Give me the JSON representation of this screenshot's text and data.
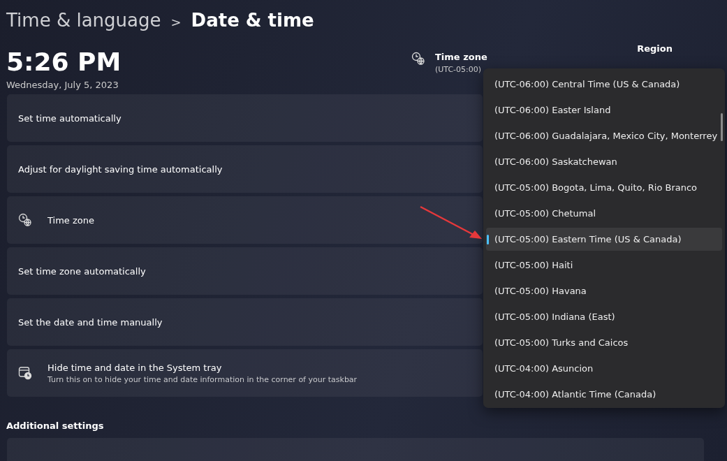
{
  "breadcrumb": {
    "parent": "Time & language",
    "separator": ">",
    "current": "Date & time"
  },
  "clock": {
    "time": "5:26 PM",
    "date": "Wednesday, July 5, 2023"
  },
  "time_zone_info": {
    "title": "Time zone",
    "value": "(UTC-05:00)"
  },
  "region_info": {
    "title": "Region"
  },
  "settings": [
    {
      "kind": "plain",
      "label": "Set time automatically"
    },
    {
      "kind": "plain",
      "label": "Adjust for daylight saving time automatically"
    },
    {
      "kind": "timezone",
      "label": "Time zone"
    },
    {
      "kind": "plain",
      "label": "Set time zone automatically"
    },
    {
      "kind": "plain",
      "label": "Set the date and time manually"
    },
    {
      "kind": "tray",
      "label": "Hide time and date in the System tray",
      "description": "Turn this on to hide your time and date information in the corner of your taskbar"
    }
  ],
  "additional_settings": {
    "heading": "Additional settings"
  },
  "timezone_dropdown": [
    {
      "label": "(UTC-06:00) Central Time (US & Canada)",
      "selected": false
    },
    {
      "label": "(UTC-06:00) Easter Island",
      "selected": false
    },
    {
      "label": "(UTC-06:00) Guadalajara, Mexico City, Monterrey",
      "selected": false
    },
    {
      "label": "(UTC-06:00) Saskatchewan",
      "selected": false
    },
    {
      "label": "(UTC-05:00) Bogota, Lima, Quito, Rio Branco",
      "selected": false
    },
    {
      "label": "(UTC-05:00) Chetumal",
      "selected": false
    },
    {
      "label": "(UTC-05:00) Eastern Time (US & Canada)",
      "selected": true
    },
    {
      "label": "(UTC-05:00) Haiti",
      "selected": false
    },
    {
      "label": "(UTC-05:00) Havana",
      "selected": false
    },
    {
      "label": "(UTC-05:00) Indiana (East)",
      "selected": false
    },
    {
      "label": "(UTC-05:00) Turks and Caicos",
      "selected": false
    },
    {
      "label": "(UTC-04:00) Asuncion",
      "selected": false
    },
    {
      "label": "(UTC-04:00) Atlantic Time (Canada)",
      "selected": false
    }
  ]
}
